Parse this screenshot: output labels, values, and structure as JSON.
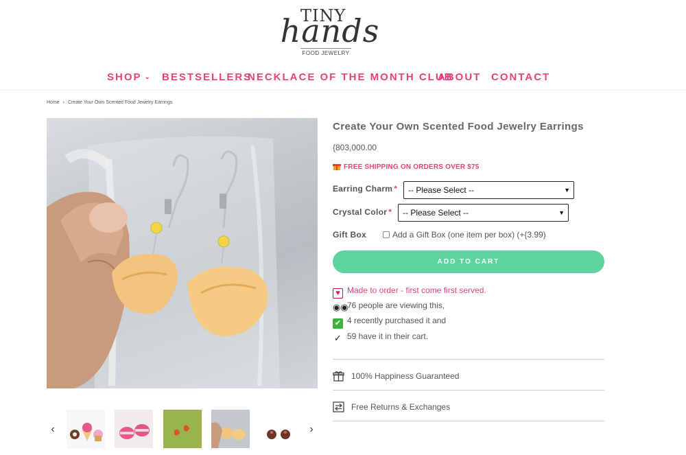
{
  "brand": {
    "tiny": "TINY",
    "hands": "hands",
    "sub": "FOOD JEWELRY"
  },
  "nav": {
    "shop": "SHOP",
    "bestsellers": "BESTSELLERS",
    "necklace_club": "NECKLACE OF THE MONTH CLUB",
    "about": "ABOUT",
    "contact": "CONTACT"
  },
  "breadcrumb": {
    "home": "Home",
    "sep": "›",
    "current": "Create Your Own Scented Food Jewelry Earrings"
  },
  "product": {
    "title": "Create Your Own Scented Food Jewelry Earrings",
    "price": "{803,000.00",
    "shipping": "FREE SHIPPING ON ORDERS OVER $75",
    "earring_charm_label": "Earring Charm",
    "crystal_color_label": "Crystal Color",
    "required_mark": "*",
    "select_placeholder": "-- Please Select --",
    "gift_box_label": "Gift Box",
    "gift_box_option": "Add a Gift Box (one item per box) (+{3.99)",
    "add_to_cart": "ADD TO CART"
  },
  "social_proof": {
    "made_to_order": "Made to order - first come first served.",
    "viewing": "76 people are viewing this,",
    "purchased": "4 recently purchased it and",
    "in_cart": "59 have it in their cart."
  },
  "features": {
    "happiness": "100% Happiness Guaranteed",
    "returns": "Free Returns & Exchanges"
  },
  "colors": {
    "accent_pink": "#e8407f",
    "cart_green": "#5dd39e"
  },
  "icons": {
    "nav_chevron": "chevron-down-icon",
    "thumb_prev": "chevron-left-icon",
    "thumb_next": "chevron-right-icon",
    "shipping": "gift-icon",
    "made_to_order": "heart-icon",
    "viewing": "eyes-icon",
    "purchased": "check-box-icon",
    "in_cart": "check-icon",
    "happiness": "gift-outline-icon",
    "returns": "exchange-icon"
  }
}
